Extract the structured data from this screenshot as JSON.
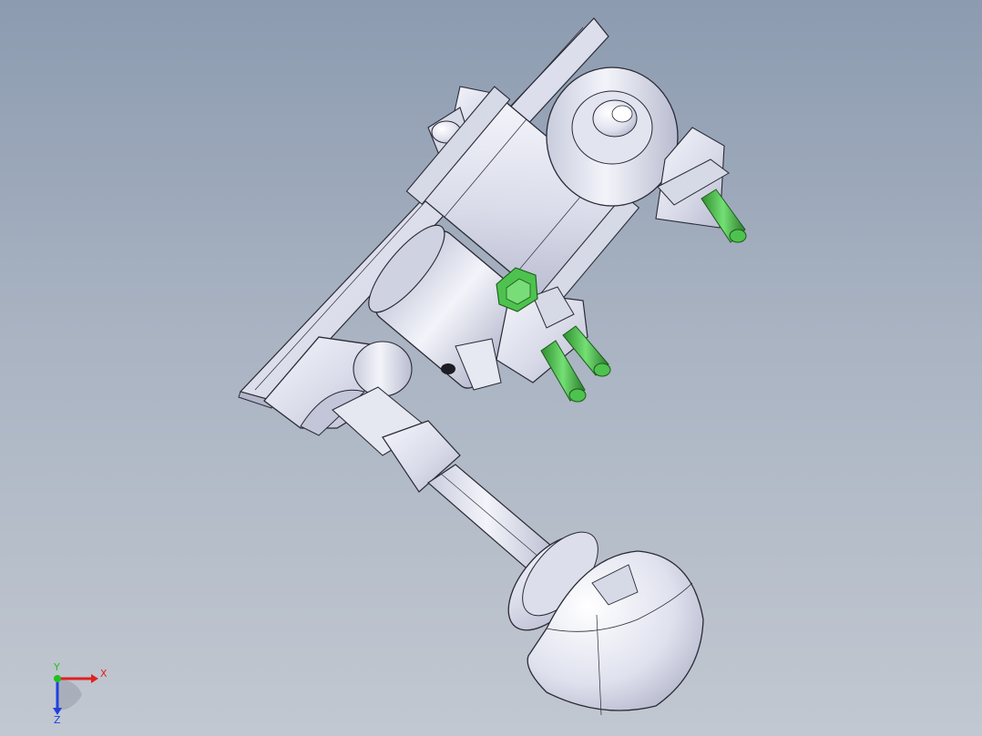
{
  "viewport": {
    "colors": {
      "bg_top": "#8c9bb0",
      "bg_bottom": "#c2c8d1",
      "part_light": "#eceef5",
      "part_mid": "#d6d9e6",
      "part_shadow": "#b3b6c9",
      "edge": "#2a2a35",
      "highlight_green": "#4ec24e"
    }
  },
  "triad": {
    "x_label": "X",
    "y_label": "Y",
    "z_label": "Z",
    "x_color": "#e02020",
    "y_color": "#20c020",
    "z_color": "#2040e0"
  }
}
